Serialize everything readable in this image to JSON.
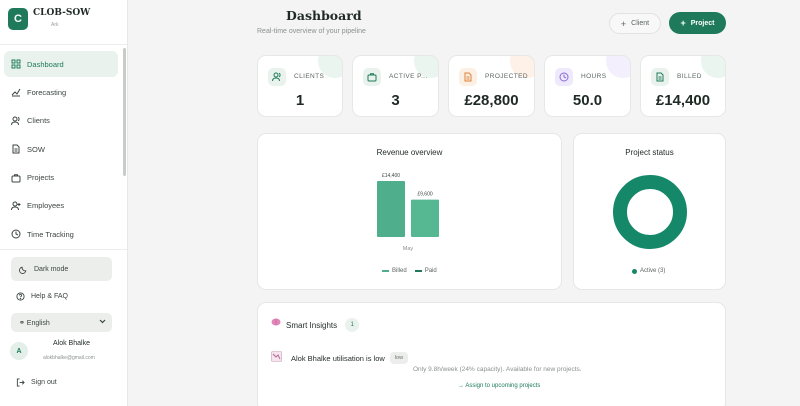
{
  "brand": {
    "name": "CLOB-SOW",
    "logo_letter": "C",
    "subtitle": "Ark"
  },
  "sidebar": {
    "items": [
      {
        "label": "Dashboard",
        "icon": "grid-icon",
        "active": true
      },
      {
        "label": "Forecasting",
        "icon": "trend-icon"
      },
      {
        "label": "Clients",
        "icon": "users-icon"
      },
      {
        "label": "SOW",
        "icon": "document-icon"
      },
      {
        "label": "Projects",
        "icon": "briefcase-icon"
      },
      {
        "label": "Employees",
        "icon": "user-plus-icon"
      },
      {
        "label": "Time Tracking",
        "icon": "clock-icon"
      }
    ],
    "dark_mode_label": "Dark mode",
    "help_label": "Help & FAQ",
    "language": "⚭ English",
    "user": {
      "initial": "A",
      "name": "Alok Bhalke",
      "email": "alokbhalke@gmail.com"
    },
    "signout_label": "Sign out"
  },
  "header": {
    "title": "Dashboard",
    "subtitle": "Real-time overview of your pipeline",
    "client_button": "Client",
    "project_button": "Project"
  },
  "stats": [
    {
      "label": "CLIENTS",
      "value": "1",
      "icon": "users-icon",
      "color": "#1e7a5a",
      "bg": "#e9f2ed",
      "blob": "#d9ece2"
    },
    {
      "label": "ACTIVE P...",
      "value": "3",
      "icon": "briefcase-icon",
      "color": "#1e7a5a",
      "bg": "#e9f2ed",
      "blob": "#d9ece2"
    },
    {
      "label": "PROJECTED",
      "value": "£28,800",
      "icon": "document-icon",
      "color": "#e0803a",
      "bg": "#fcefe4",
      "blob": "#fbe6d6"
    },
    {
      "label": "HOURS",
      "value": "50.0",
      "icon": "clock-icon",
      "color": "#8a6ad8",
      "bg": "#efeafb",
      "blob": "#e9e2fa"
    },
    {
      "label": "BILLED",
      "value": "£14,400",
      "icon": "document-icon",
      "color": "#1e7a5a",
      "bg": "#e9f2ed",
      "blob": "#d9ece2"
    }
  ],
  "revenue": {
    "title": "Revenue overview",
    "legend": [
      "Billed",
      "Paid"
    ]
  },
  "status": {
    "title": "Project status",
    "legend_label": "Active (3)"
  },
  "chart_data": [
    {
      "type": "bar",
      "title": "Revenue overview",
      "categories": [
        "May"
      ],
      "series": [
        {
          "name": "Billed",
          "values": [
            14400
          ],
          "color": "#4fae8b"
        },
        {
          "name": "Paid",
          "values": [
            9600
          ],
          "color": "#56b893"
        }
      ],
      "data_labels": [
        "£14,400",
        "£9,600"
      ],
      "legend": "bottom",
      "grid": false
    },
    {
      "type": "pie",
      "title": "Project status",
      "labels": [
        "Active"
      ],
      "values": [
        3
      ],
      "colors": [
        "#16886a"
      ],
      "legend": "bottom"
    }
  ],
  "insights": {
    "title": "Smart Insights",
    "count": "1",
    "item": {
      "title": "Alok Bhalke utilisation is low",
      "tag": "low",
      "description": "Only 9.8h/week (24% capacity). Available for new projects.",
      "action": "→ Assign to upcoming projects"
    }
  }
}
